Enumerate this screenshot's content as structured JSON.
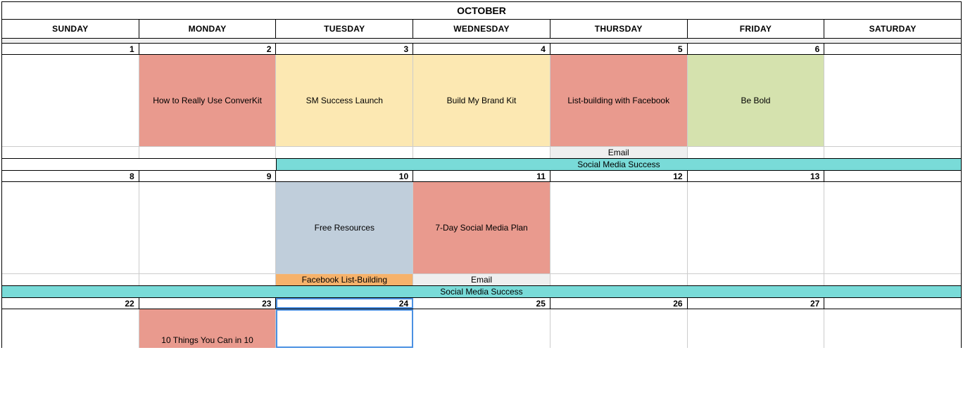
{
  "month": "OCTOBER",
  "days": [
    "SUNDAY",
    "MONDAY",
    "TUESDAY",
    "WEDNESDAY",
    "THURSDAY",
    "FRIDAY",
    "SATURDAY"
  ],
  "w1": {
    "dates": [
      "1",
      "2",
      "3",
      "4",
      "5",
      "6",
      ""
    ],
    "events": {
      "mon": "How to Really Use ConverKit",
      "tue": "SM Success Launch",
      "wed": "Build My Brand Kit",
      "thu": "List-building with Facebook",
      "fri": "Be Bold"
    },
    "sub_thu": "Email",
    "span": "Social Media Success"
  },
  "w2": {
    "dates": [
      "8",
      "9",
      "10",
      "11",
      "12",
      "13",
      ""
    ],
    "events": {
      "tue": "Free Resources",
      "wed": "7-Day Social Media Plan"
    },
    "sub_tue": "Facebook List-Building",
    "sub_wed": "Email",
    "span": "Social Media Success"
  },
  "w3": {
    "dates": [
      "22",
      "23",
      "24",
      "25",
      "26",
      "27",
      ""
    ],
    "events": {
      "mon": "10 Things You Can in 10"
    }
  }
}
